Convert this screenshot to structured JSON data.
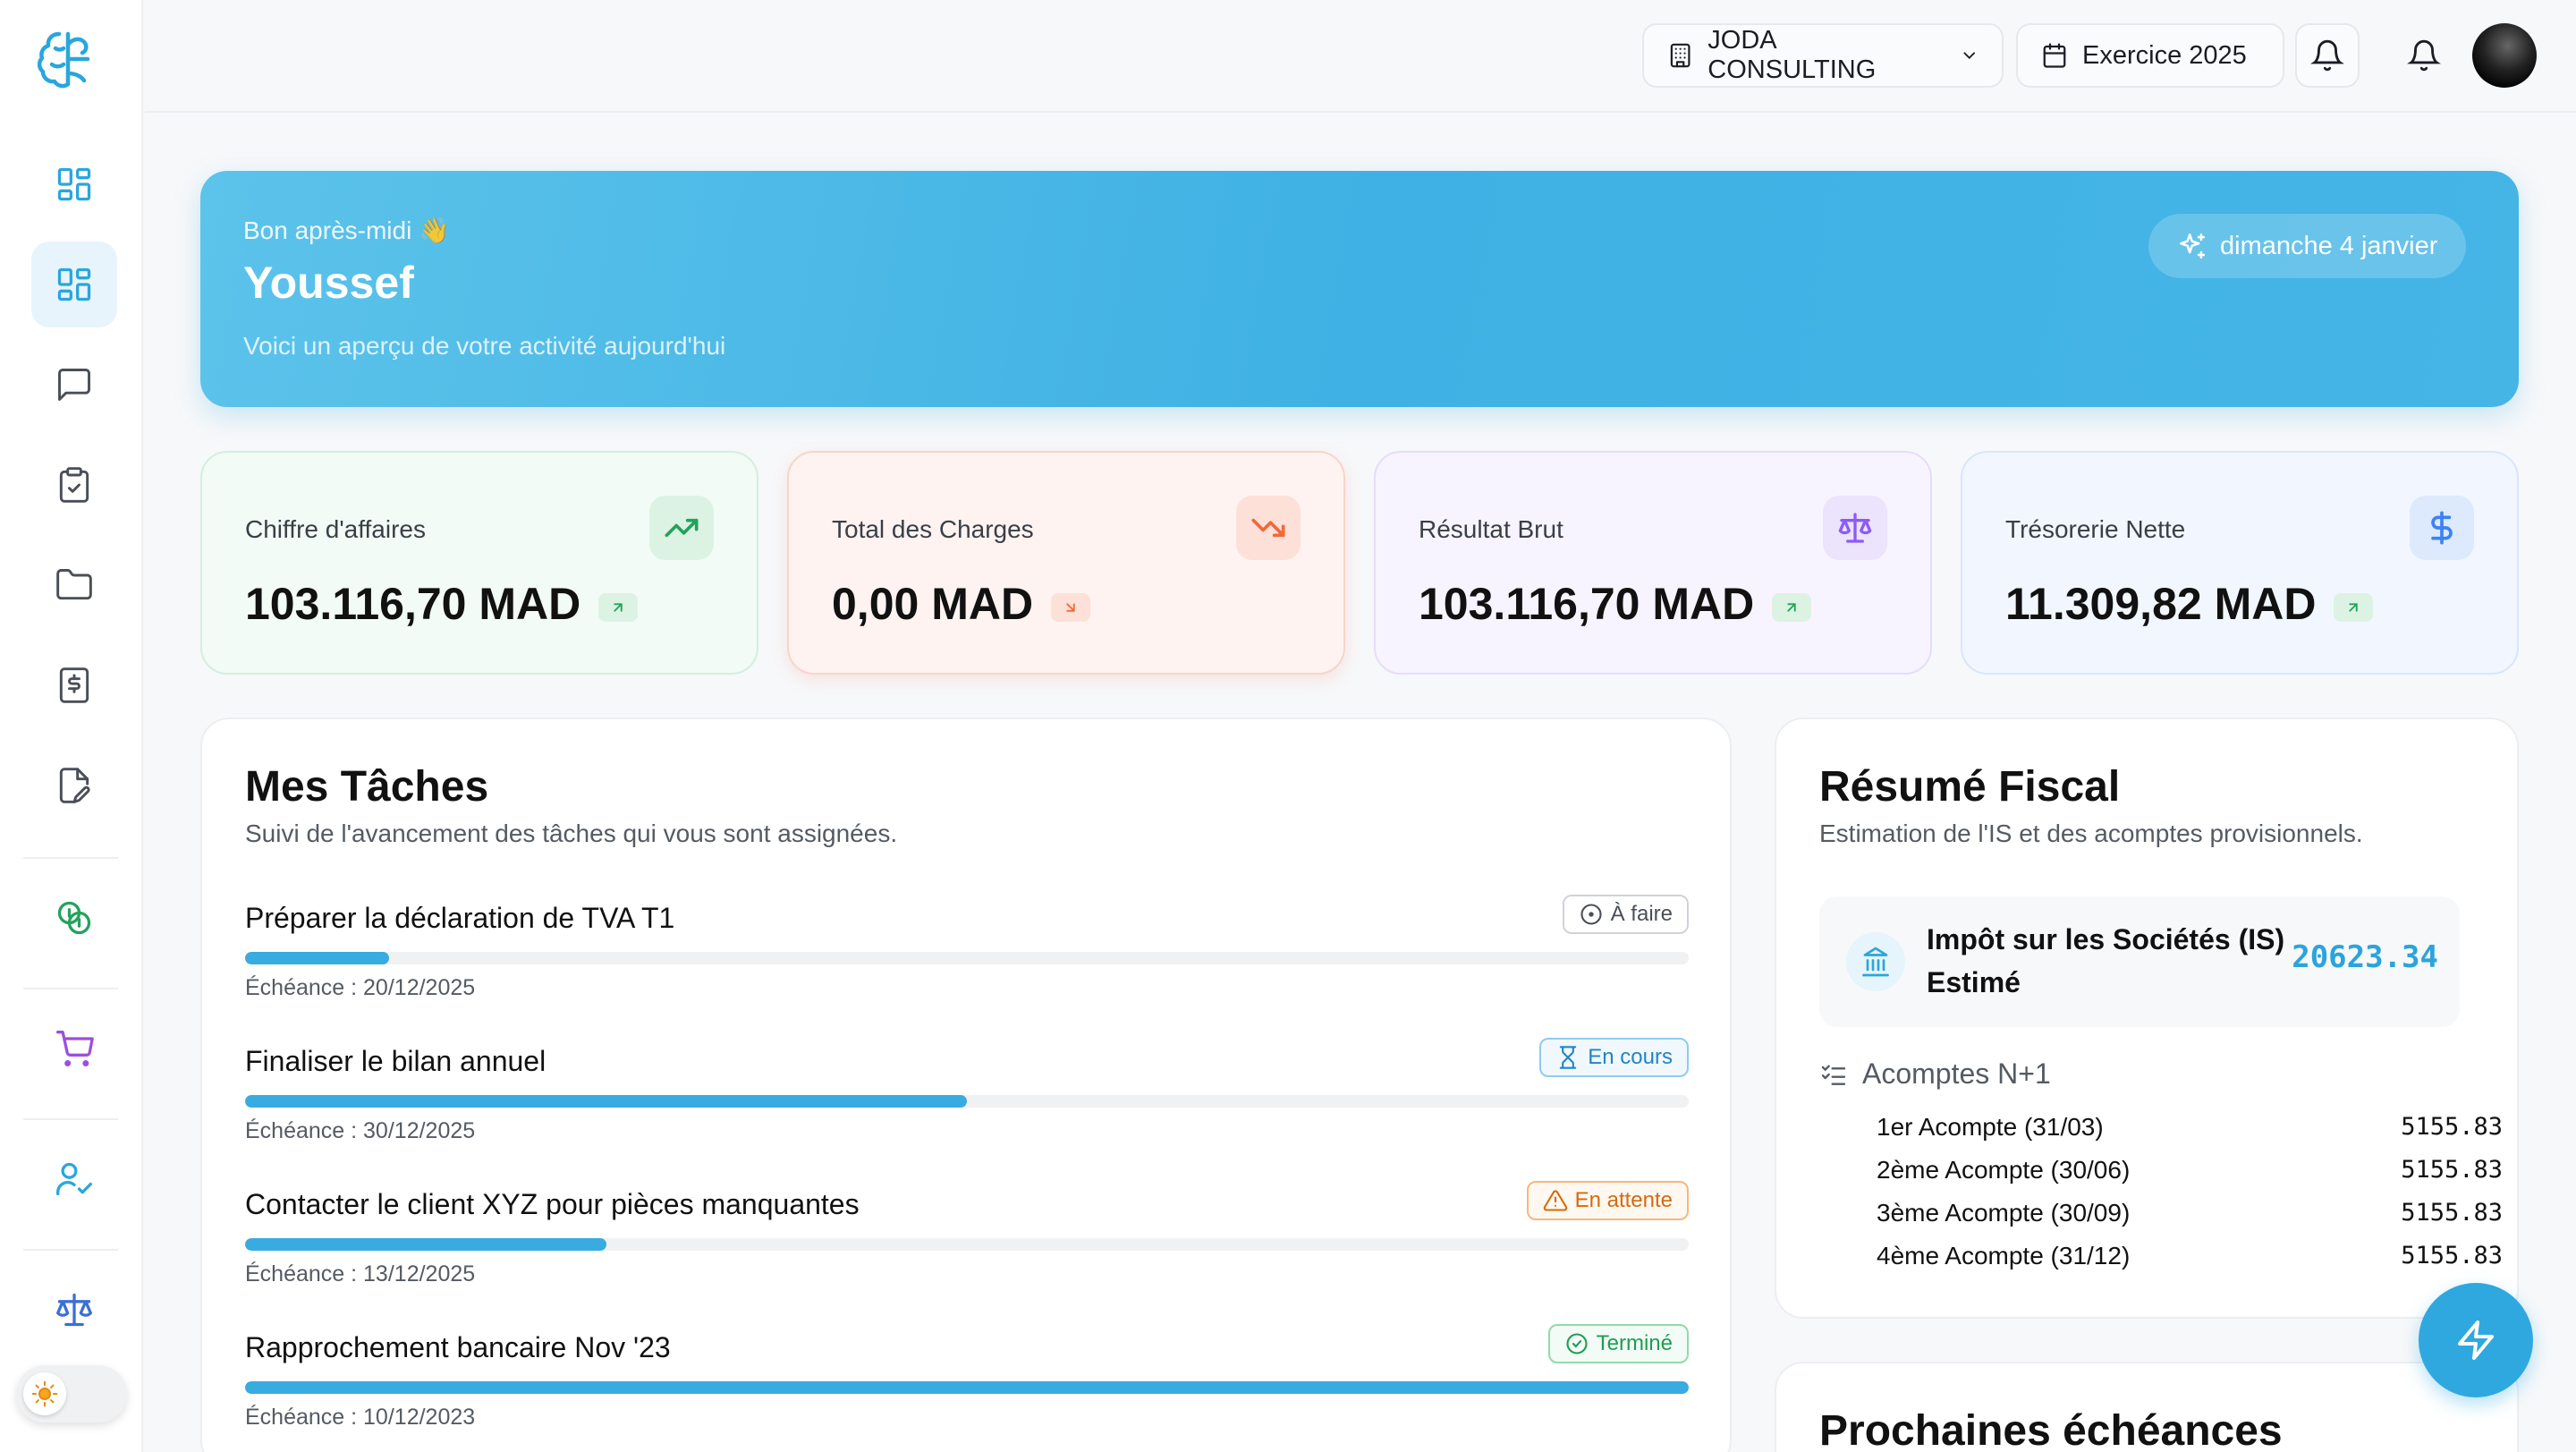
{
  "sidebar": {
    "logo": "brain-logo",
    "items": [
      {
        "icon": "grid-icon",
        "active": false
      },
      {
        "icon": "dashboard-icon",
        "active": true
      },
      {
        "icon": "message-icon",
        "active": false
      },
      {
        "icon": "clipboard-check-icon",
        "active": false
      },
      {
        "icon": "folder-icon",
        "active": false
      },
      {
        "icon": "receipt-dollar-icon",
        "active": false
      },
      {
        "icon": "file-edit-icon",
        "active": false
      },
      {
        "icon": "coins-icon",
        "active": false
      },
      {
        "icon": "cart-icon",
        "active": false
      },
      {
        "icon": "user-check-icon",
        "active": false
      },
      {
        "icon": "scale-icon",
        "active": false
      }
    ],
    "theme_toggle": "sun-icon"
  },
  "topbar": {
    "company": "JODA CONSULTING",
    "exercise": "Exercice 2025"
  },
  "hero": {
    "greeting": "Bon après-midi 👋",
    "name": "Youssef",
    "subtitle": "Voici un aperçu de votre activité aujourd'hui",
    "date": "dimanche 4 janvier"
  },
  "kpis": [
    {
      "label": "Chiffre d'affaires",
      "value": "103.116,70 MAD",
      "trend": "up",
      "color": "#22a35a"
    },
    {
      "label": "Total des Charges",
      "value": "0,00 MAD",
      "trend": "down",
      "color": "#f06a3a"
    },
    {
      "label": "Résultat Brut",
      "value": "103.116,70 MAD",
      "trend": "up",
      "color": "#8b5cf6"
    },
    {
      "label": "Trésorerie Nette",
      "value": "11.309,82 MAD",
      "trend": "up",
      "color": "#3b82f6"
    }
  ],
  "tasks": {
    "title": "Mes Tâches",
    "subtitle": "Suivi de l'avancement des tâches qui vous sont assignées.",
    "items": [
      {
        "title": "Préparer la déclaration de TVA T1",
        "status": "À faire",
        "status_icon": "circle-dots-icon",
        "progress": 0.1,
        "due": "Échéance : 20/12/2025"
      },
      {
        "title": "Finaliser le bilan annuel",
        "status": "En cours",
        "status_icon": "hourglass-icon",
        "progress": 0.5,
        "due": "Échéance : 30/12/2025"
      },
      {
        "title": "Contacter le client XYZ pour pièces manquantes",
        "status": "En attente",
        "status_icon": "warning-icon",
        "progress": 0.25,
        "due": "Échéance : 13/12/2025"
      },
      {
        "title": "Rapprochement bancaire Nov '23",
        "status": "Terminé",
        "status_icon": "check-circle-icon",
        "progress": 1.0,
        "due": "Échéance : 10/12/2023"
      }
    ]
  },
  "fiscal": {
    "title": "Résumé Fiscal",
    "subtitle": "Estimation de l'IS et des acomptes provisionnels.",
    "is_label_1": "Impôt sur les Sociétés (IS)",
    "is_label_2": "Estimé",
    "is_value": "20623.34",
    "acomptes_title": "Acomptes N+1",
    "acomptes": [
      {
        "label": "1er Acompte (31/03)",
        "value": "5155.83"
      },
      {
        "label": "2ème Acompte (30/06)",
        "value": "5155.83"
      },
      {
        "label": "3ème Acompte (30/09)",
        "value": "5155.83"
      },
      {
        "label": "4ème Acompte (31/12)",
        "value": "5155.83"
      }
    ]
  },
  "deadlines": {
    "title": "Prochaines échéances"
  },
  "fab": "lightning-icon"
}
